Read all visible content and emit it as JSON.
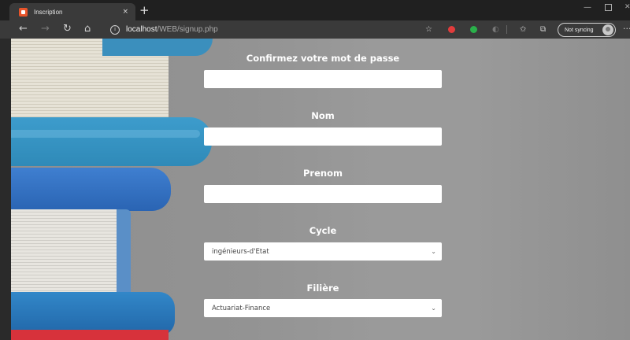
{
  "browser": {
    "tab_title": "Inscription",
    "tab_close": "×",
    "new_tab": "+",
    "back": "←",
    "forward": "→",
    "refresh": "↻",
    "home": "⌂",
    "url_host": "localhost",
    "url_path": "/WEB/signup.php",
    "favorite_icon": "☆",
    "favorites_bar_icon": "✩",
    "collections_icon": "⧉",
    "sync_label": "Not syncing",
    "more": "···",
    "window_minimize": "—",
    "window_close": "✕"
  },
  "form": {
    "confirm_password_label": "Confirmez votre mot de passe",
    "nom_label": "Nom",
    "prenom_label": "Prenom",
    "cycle_label": "Cycle",
    "cycle_value": "ingénieurs-d'Etat",
    "filiere_label": "Filière",
    "filiere_value": "Actuariat-Finance"
  }
}
